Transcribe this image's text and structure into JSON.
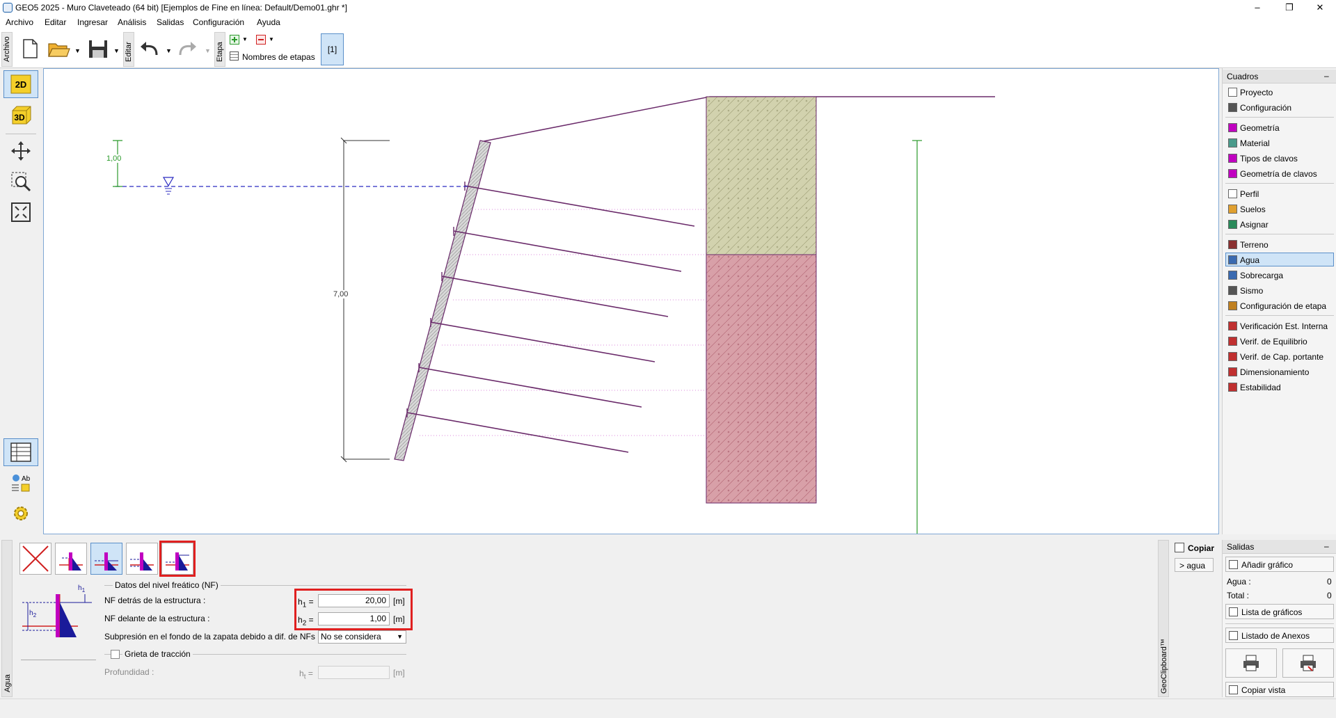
{
  "window": {
    "title": "GEO5 2025 - Muro Claveteado (64 bit) [Ejemplos de Fine en línea: Default/Demo01.ghr *]",
    "min_symbol": "–",
    "max_symbol": "❐",
    "close_symbol": "✕"
  },
  "menu": [
    "Archivo",
    "Editar",
    "Ingresar",
    "Análisis",
    "Salidas",
    "Configuración",
    "Ayuda"
  ],
  "toolbar": {
    "archivo_tab": "Archivo",
    "editar_tab": "Editar",
    "etapa_tab": "Etapa",
    "stage_names_label": "Nombres de etapas",
    "stage_button": "[1]"
  },
  "canvas": {
    "dim_water": "1,00",
    "dim_height": "7,00"
  },
  "right_panel": {
    "header": "Cuadros",
    "collapse": "–",
    "groups": [
      [
        {
          "label": "Proyecto",
          "icon": "document-icon",
          "color": "#ffffff"
        },
        {
          "label": "Configuración",
          "icon": "gear-icon",
          "color": "#555555"
        }
      ],
      [
        {
          "label": "Geometría",
          "icon": "geometry-icon",
          "color": "#c000c0"
        },
        {
          "label": "Material",
          "icon": "material-icon",
          "color": "#4a9a8a"
        },
        {
          "label": "Tipos de clavos",
          "icon": "nail-type-icon",
          "color": "#c000c0"
        },
        {
          "label": "Geometría de clavos",
          "icon": "nail-geometry-icon",
          "color": "#c000c0"
        }
      ],
      [
        {
          "label": "Perfil",
          "icon": "profile-icon",
          "color": "#ffffff"
        },
        {
          "label": "Suelos",
          "icon": "soils-icon",
          "color": "#e0a030"
        },
        {
          "label": "Asignar",
          "icon": "assign-icon",
          "color": "#2a8a5a"
        }
      ],
      [
        {
          "label": "Terreno",
          "icon": "terrain-icon",
          "color": "#8a3030"
        },
        {
          "label": "Agua",
          "icon": "water-icon",
          "color": "#3a6ab0",
          "selected": true
        },
        {
          "label": "Sobrecarga",
          "icon": "surcharge-icon",
          "color": "#3a6ab0"
        },
        {
          "label": "Sismo",
          "icon": "earthquake-icon",
          "color": "#555555"
        },
        {
          "label": "Configuración de etapa",
          "icon": "stage-settings-icon",
          "color": "#c08020"
        }
      ],
      [
        {
          "label": "Verificación Est. Interna",
          "icon": "internal-check-icon",
          "color": "#c03030"
        },
        {
          "label": "Verif. de Equilibrio",
          "icon": "equilibrium-icon",
          "color": "#c03030"
        },
        {
          "label": "Verif. de Cap. portante",
          "icon": "bearing-icon",
          "color": "#c03030"
        },
        {
          "label": "Dimensionamiento",
          "icon": "dimensioning-icon",
          "color": "#c03030"
        },
        {
          "label": "Estabilidad",
          "icon": "stability-icon",
          "color": "#c03030"
        }
      ]
    ]
  },
  "bottom": {
    "side_tab": "Agua",
    "group_title": "Datos del nivel freático (NF)",
    "row1_label": "NF detrás de la estructura :",
    "row1_sym": "h",
    "row1_sub": "1",
    "row1_value": "20,00",
    "row1_unit": "[m]",
    "row2_label": "NF delante de la estructura :",
    "row2_sym": "h",
    "row2_sub": "2",
    "row2_value": "1,00",
    "row2_unit": "[m]",
    "uplift_label": "Subpresión en el fondo de la zapata debido a dif. de NFs :",
    "uplift_value": "No se considera",
    "crack_label": "Grieta de tracción",
    "depth_label": "Profundidad :",
    "depth_sym": "h",
    "depth_sub": "t",
    "depth_unit": "[m]",
    "equals": "=",
    "diagram_h1": "h",
    "diagram_h1_sub": "1",
    "diagram_h2": "h",
    "diagram_h2_sub": "2"
  },
  "clipboard": {
    "tab": "GeoClipboard™",
    "copy_label": "Copiar",
    "item_label": "> agua"
  },
  "outputs": {
    "header": "Salidas",
    "collapse": "–",
    "add_chart": "Añadir gráfico",
    "agua_label": "Agua :",
    "agua_count": "0",
    "total_label": "Total :",
    "total_count": "0",
    "chart_list": "Lista de gráficos",
    "annex_list": "Listado de Anexos",
    "copy_view": "Copiar vista"
  },
  "colors": {
    "accent": "#5a8fc9",
    "structure": "#6a2a6a",
    "soil_top": "#d2d2ae",
    "soil_bottom": "#d8a0a8",
    "water": "#2a2ac0",
    "highlight": "#e02020"
  }
}
